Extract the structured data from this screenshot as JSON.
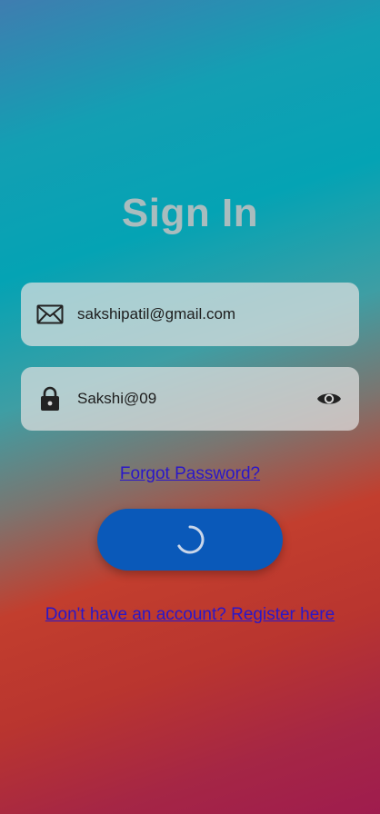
{
  "header": {
    "title": "Sign In"
  },
  "form": {
    "email": {
      "value": "sakshipatil@gmail.com",
      "icon": "envelope-icon"
    },
    "password": {
      "value": "Sakshi@09",
      "icon": "lock-icon",
      "toggle_icon": "eye-icon"
    },
    "forgot_password_label": "Forgot Password?",
    "submit": {
      "state": "loading",
      "icon": "loading-spinner-icon"
    },
    "register_link_label": "Don't have an account? Register here"
  },
  "colors": {
    "button": "#0a59b9",
    "link": "#2a17c8",
    "title": "#a9bcbe",
    "field_background": "#e1e1e1"
  }
}
